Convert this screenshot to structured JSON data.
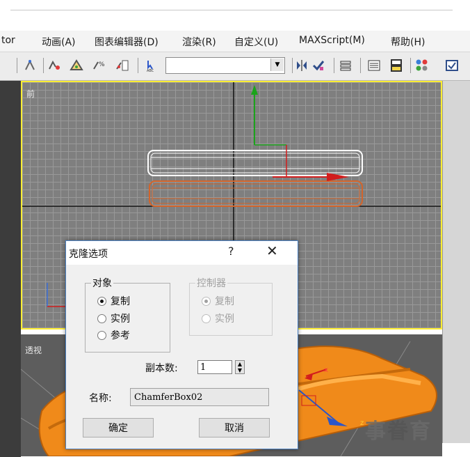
{
  "menu": {
    "items": [
      "tor",
      "动画(A)",
      "图表编辑器(D)",
      "渲染(R)",
      "自定义(U)",
      "MAXScript(M)",
      "帮助(H)"
    ]
  },
  "toolbar": {
    "icons": [
      "snap-icon",
      "rotate-snap-icon",
      "angle-snap-icon",
      "percent-snap-icon",
      "spinner-snap-icon",
      "edit-named-selection-icon",
      "mirror-icon",
      "align-icon",
      "layer-manager-icon",
      "curve-editor-icon",
      "schematic-view-icon",
      "material-editor-icon"
    ],
    "named_selection_value": ""
  },
  "viewports": {
    "front_label": "前",
    "perspective_label": "透视"
  },
  "dialog": {
    "title": "克隆选项",
    "help": "?",
    "close": "✕",
    "object_group": {
      "title": "对象",
      "options": [
        {
          "label": "复制",
          "selected": true
        },
        {
          "label": "实例",
          "selected": false
        },
        {
          "label": "参考",
          "selected": false
        }
      ]
    },
    "controller_group": {
      "title": "控制器",
      "options": [
        {
          "label": "复制",
          "selected": true
        },
        {
          "label": "实例",
          "selected": false
        }
      ]
    },
    "copies_label": "副本数:",
    "copies_value": "1",
    "name_label": "名称:",
    "name_value": "ChamferBox02",
    "ok_label": "确定",
    "cancel_label": "取消"
  },
  "watermark": {
    "left": "事",
    "middle": "眷",
    "right": "育"
  },
  "colors": {
    "viewport_active_border": "#ffee33",
    "selected_object": "#ffffff",
    "clone_object": "#d3642a",
    "gizmo_y": "#1ba41b",
    "gizmo_x": "#d21d1d",
    "dialog_border": "#4a7fc0",
    "chamferbox_fill": "#f08a1a"
  }
}
